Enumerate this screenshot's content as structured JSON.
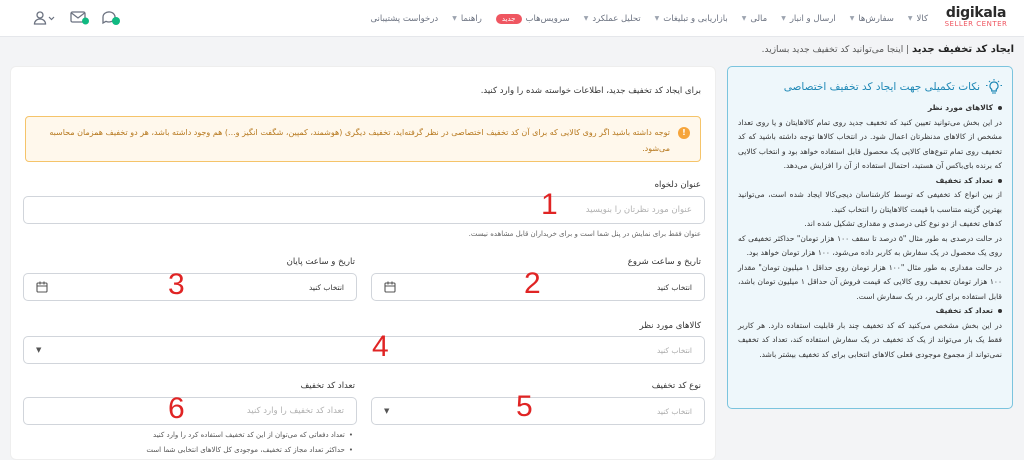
{
  "brand": {
    "name": "digikala",
    "sub": "SELLER CENTER"
  },
  "nav": [
    {
      "label": "کالا",
      "caret": true
    },
    {
      "label": "سفارش‌ها",
      "caret": true
    },
    {
      "label": "ارسال و انبار",
      "caret": true
    },
    {
      "label": "مالی",
      "caret": true
    },
    {
      "label": "بازاریابی و تبلیغات",
      "caret": true
    },
    {
      "label": "تحلیل عملکرد",
      "caret": true
    },
    {
      "label": "سرویس‌هاب",
      "badge": "جدید"
    },
    {
      "label": "راهنما",
      "caret": true
    },
    {
      "label": "درخواست پشتیبانی"
    }
  ],
  "page": {
    "title": "ایجاد کد تخفیف جدید",
    "subtitle": "اینجا می‌توانید کد تخفیف جدید بسازید."
  },
  "form": {
    "intro": "برای ایجاد کد تخفیف جدید، اطلاعات خواسته شده را وارد کنید.",
    "warning": "توجه داشته باشید اگر روی کالایی که برای آن کد تخفیف اختصاصی در نظر گرفته‌اید، تخفیف دیگری (هوشمند، کمپین، شگفت انگیز و...) هم وجود داشته باشد، هر دو تخفیف همزمان محاسبه می‌شود.",
    "title_label": "عنوان دلخواه",
    "title_placeholder": "عنوان مورد نظرتان را بنویسید",
    "title_hint": "عنوان فقط برای نمایش در پنل شما است و برای خریداران قابل مشاهده نیست.",
    "start_label": "تاریخ و ساعت شروع",
    "end_label": "تاریخ و ساعت پایان",
    "date_value": "انتخاب کنید",
    "products_label": "کالاهای مورد نظر",
    "products_placeholder": "انتخاب کنید",
    "type_label": "نوع کد تخفیف",
    "type_placeholder": "انتخاب کنید",
    "count_label": "تعداد کد تخفیف",
    "count_placeholder": "تعداد کد تخفیف را وارد کنید",
    "count_hints": [
      "تعداد دفعاتی که می‌توان از این کد تخفیف استفاده کرد را وارد کنید",
      "حداکثر تعداد مجاز کد تخفیف، موجودی کل کالاهای انتخابی شما است"
    ]
  },
  "markers": [
    "1",
    "2",
    "3",
    "4",
    "5",
    "6"
  ],
  "tips": {
    "title": "نکات تکمیلی جهت ایجاد کد تخفیف اختصاصی",
    "sections": [
      {
        "heading": "کالاهای مورد نظر",
        "paragraphs": [
          "در این بخش می‌توانید تعیین کنید که تخفیف جدید روی تمام کالاهایتان و یا روی تعداد مشخص از کالاهای مدنظرتان اعمال شود. در انتخاب کالاها توجه داشته باشید که کد تخفیف روی تمام تنوع‌های کالایی یک محصول قابل استفاده خواهد بود و انتخاب کالایی که برنده بای‌باکس آن هستید، احتمال استفاده از آن را افزایش می‌دهد."
        ]
      },
      {
        "heading": "تعداد کد تخفیف",
        "paragraphs": [
          "از بین انواع کد تخفیفی که توسط کارشناسان دیجی‌کالا ایجاد شده است، می‌توانید بهترین گزینه متناسب با قیمت کالاهایتان را انتخاب کنید.",
          "کدهای تخفیف از دو نوع کلی درصدی و مقداری تشکیل شده اند.",
          "در حالت درصدی به طور مثال \"۵ درصد تا سقف ۱۰۰ هزار تومان\" حداکثر تخفیفی که روی یک محصول در یک سفارش به کاربر داده می‌شود، ۱۰۰ هزار تومان خواهد بود.",
          "در حالت مقداری به طور مثال \"۱۰۰ هزار تومان روی حداقل ۱ میلیون تومان\" مقدار ۱۰۰ هزار تومان تخفیف روی کالایی که قیمت فروش آن حداقل ۱ میلیون تومان باشد، قابل استفاده برای کاربر، در یک سفارش است."
        ]
      },
      {
        "heading": "تعداد کد تخفیف",
        "paragraphs": [
          "در این بخش مشخص می‌کنید که کد تخفیف چند بار قابلیت استفاده دارد. هر کاربر فقط یک بار می‌تواند از یک کد تخفیف در یک سفارش استفاده کند، تعداد کد تخفیف نمی‌تواند از مجموع موجودی فعلی کالاهای انتخابی برای کد تخفیف بیشتر باشد."
        ]
      }
    ]
  },
  "colors": {
    "accent": "#1e88b6",
    "brand": "#ef5661",
    "warn": "#b7791f",
    "marker": "#e02424"
  }
}
